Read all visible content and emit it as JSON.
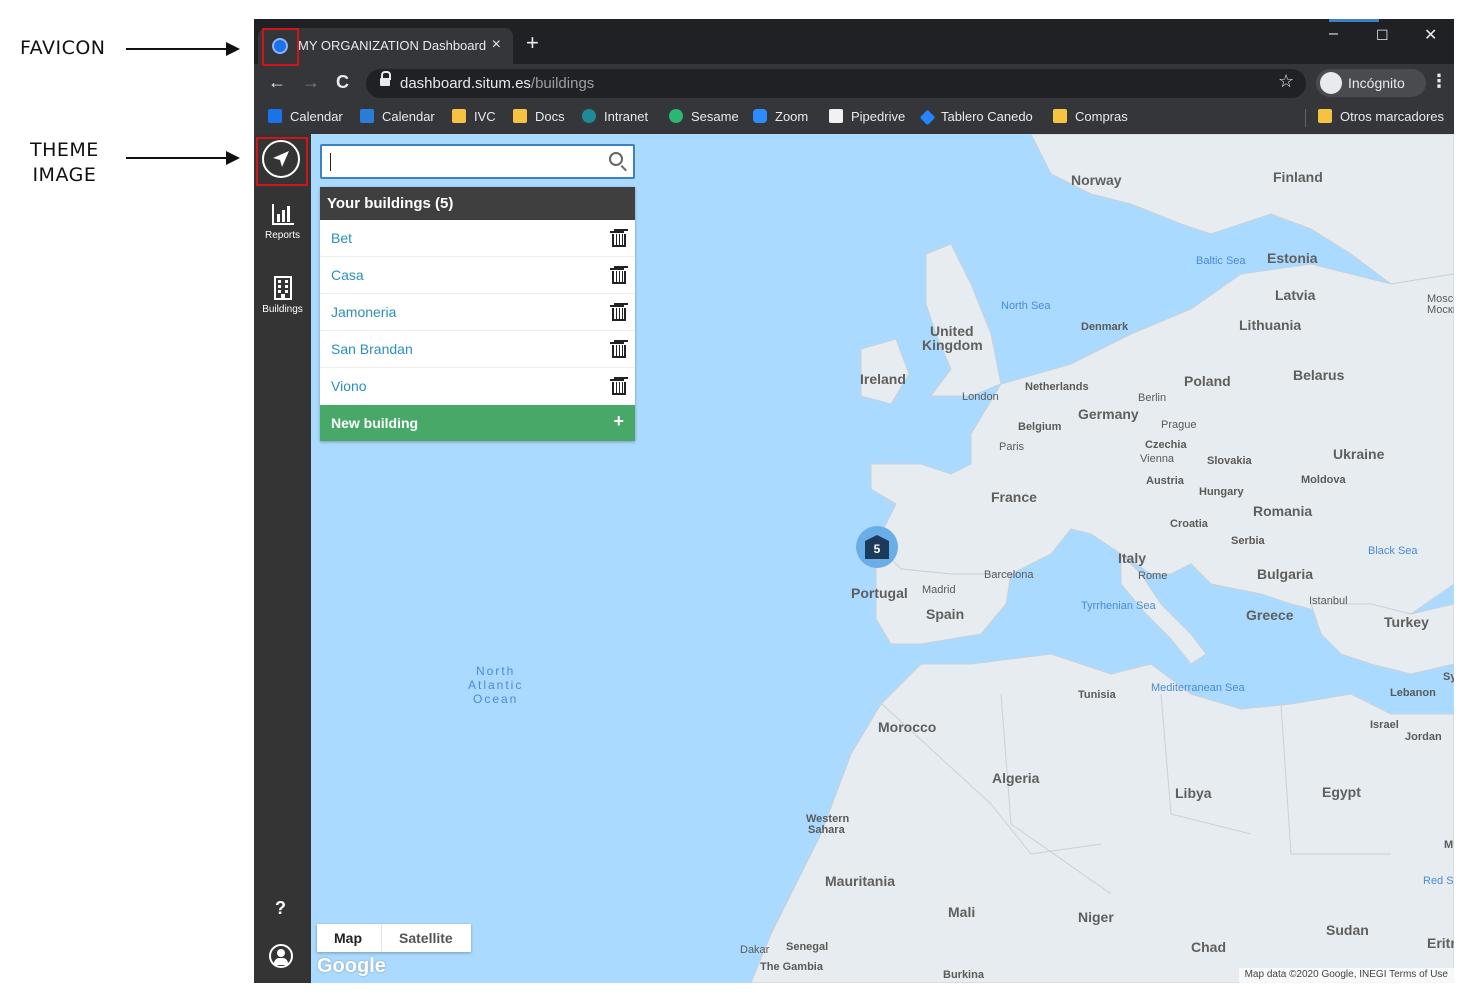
{
  "annotations": {
    "favicon": "FAVICON",
    "theme_line1": "THEME",
    "theme_line2": "IMAGE"
  },
  "browser": {
    "tab_title": "MY ORGANIZATION Dashboard",
    "tab_close": "×",
    "new_tab": "+",
    "url_host": "dashboard.situm.es",
    "url_path": "/buildings",
    "incognito_label": "Incógnito",
    "minimize": "–",
    "maximize": "☐",
    "close": "✕",
    "back": "←",
    "forward": "→",
    "reload": "C",
    "bookmark_star": "☆",
    "menu": "⋮"
  },
  "bookmarks": [
    {
      "label": "Calendar",
      "color": "#1a73e8"
    },
    {
      "label": "Calendar",
      "color": "#2a7dd6"
    },
    {
      "label": "IVC",
      "color": "#f5c242"
    },
    {
      "label": "Docs",
      "color": "#f5c242"
    },
    {
      "label": "Intranet",
      "color": "#1e8a9a"
    },
    {
      "label": "Sesame",
      "color": "#2bb673"
    },
    {
      "label": "Zoom",
      "color": "#2d8cff"
    },
    {
      "label": "Pipedrive",
      "color": "#222222"
    },
    {
      "label": "Tablero Canedo",
      "color": "#2684ff"
    },
    {
      "label": "Compras",
      "color": "#f5c242"
    }
  ],
  "other_bookmarks": "Otros marcadores",
  "sidebar": {
    "reports_label": "Reports",
    "buildings_label": "Buildings",
    "help_label": "?"
  },
  "buildings": {
    "header": "Your buildings (5)",
    "items": [
      "Bet",
      "Casa",
      "Jamoneria",
      "San Brandan",
      "Viono"
    ],
    "new_label": "New building",
    "new_icon": "+"
  },
  "map": {
    "cluster_count": "5",
    "type_map": "Map",
    "type_satellite": "Satellite",
    "google": "Google",
    "attribution": "Map data ©2020 Google, INEGI    Terms of Use",
    "labels": {
      "norway": "Norway",
      "finland": "Finland",
      "estonia": "Estonia",
      "baltic": "Baltic Sea",
      "latvia": "Latvia",
      "moscow": "Moscow",
      "moscow_ru": "Москва",
      "northsea": "North Sea",
      "denmark": "Denmark",
      "lithuania": "Lithuania",
      "uk1": "United",
      "uk2": "Kingdom",
      "ireland": "Ireland",
      "belarus": "Belarus",
      "netherlands": "Netherlands",
      "poland": "Poland",
      "london": "London",
      "berlin": "Berlin",
      "germany": "Germany",
      "belgium": "Belgium",
      "prague": "Prague",
      "czechia": "Czechia",
      "paris": "Paris",
      "vienna": "Vienna",
      "slovakia": "Slovakia",
      "ukraine": "Ukraine",
      "austria": "Austria",
      "moldova": "Moldova",
      "hungary": "Hungary",
      "france": "France",
      "romania": "Romania",
      "croatia": "Croatia",
      "serbia": "Serbia",
      "blacksea": "Black Sea",
      "italy": "Italy",
      "barcelona": "Barcelona",
      "rome": "Rome",
      "bulgaria": "Bulgaria",
      "portugal": "Portugal",
      "madrid": "Madrid",
      "spain": "Spain",
      "istanbul": "Istanbul",
      "tyrrhenian": "Tyrrhenian Sea",
      "greece": "Greece",
      "turkey": "Turkey",
      "ocean1": "North",
      "ocean2": "Atlantic",
      "ocean3": "Ocean",
      "syria": "Syri",
      "tunisia": "Tunisia",
      "medsea": "Mediterranean Sea",
      "lebanon": "Lebanon",
      "morocco": "Morocco",
      "israel": "Israel",
      "jordan": "Jordan",
      "algeria": "Algeria",
      "libya": "Libya",
      "egypt": "Egypt",
      "ws1": "Western",
      "ws2": "Sahara",
      "mauritania": "Mauritania",
      "redsea": "Red S",
      "mali": "Mali",
      "niger": "Niger",
      "sudan": "Sudan",
      "dakar": "Dakar",
      "senegal": "Senegal",
      "chad": "Chad",
      "eritrea": "Eritr",
      "gambia": "The Gambia",
      "burkina": "Burkina",
      "m_cut": "M"
    }
  },
  "colors": {
    "map_water": "#aadaff",
    "map_land": "#e6ecef",
    "sidebar": "#343434",
    "new_building": "#48a868",
    "link": "#2a8fbd",
    "annotation_box": "#d0141a"
  }
}
